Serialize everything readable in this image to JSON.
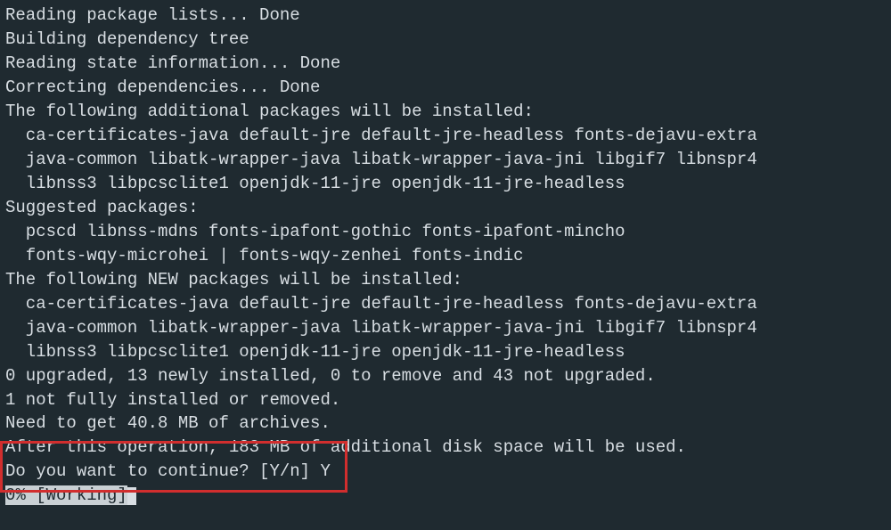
{
  "lines": {
    "l0": "Reading package lists... Done",
    "l1": "Building dependency tree",
    "l2": "Reading state information... Done",
    "l3": "Correcting dependencies... Done",
    "l4": "The following additional packages will be installed:",
    "l5": "  ca-certificates-java default-jre default-jre-headless fonts-dejavu-extra",
    "l6": "  java-common libatk-wrapper-java libatk-wrapper-java-jni libgif7 libnspr4",
    "l7": "  libnss3 libpcsclite1 openjdk-11-jre openjdk-11-jre-headless",
    "l8": "Suggested packages:",
    "l9": "  pcscd libnss-mdns fonts-ipafont-gothic fonts-ipafont-mincho",
    "l10": "  fonts-wqy-microhei | fonts-wqy-zenhei fonts-indic",
    "l11": "The following NEW packages will be installed:",
    "l12": "  ca-certificates-java default-jre default-jre-headless fonts-dejavu-extra",
    "l13": "  java-common libatk-wrapper-java libatk-wrapper-java-jni libgif7 libnspr4",
    "l14": "  libnss3 libpcsclite1 openjdk-11-jre openjdk-11-jre-headless",
    "l15": "0 upgraded, 13 newly installed, 0 to remove and 43 not upgraded.",
    "l16": "1 not fully installed or removed.",
    "l17": "Need to get 40.8 MB of archives.",
    "l18": "After this operation, 183 MB of additional disk space will be used.",
    "l19": "Do you want to continue? [Y/n] Y",
    "progress": "0% [Working]"
  }
}
